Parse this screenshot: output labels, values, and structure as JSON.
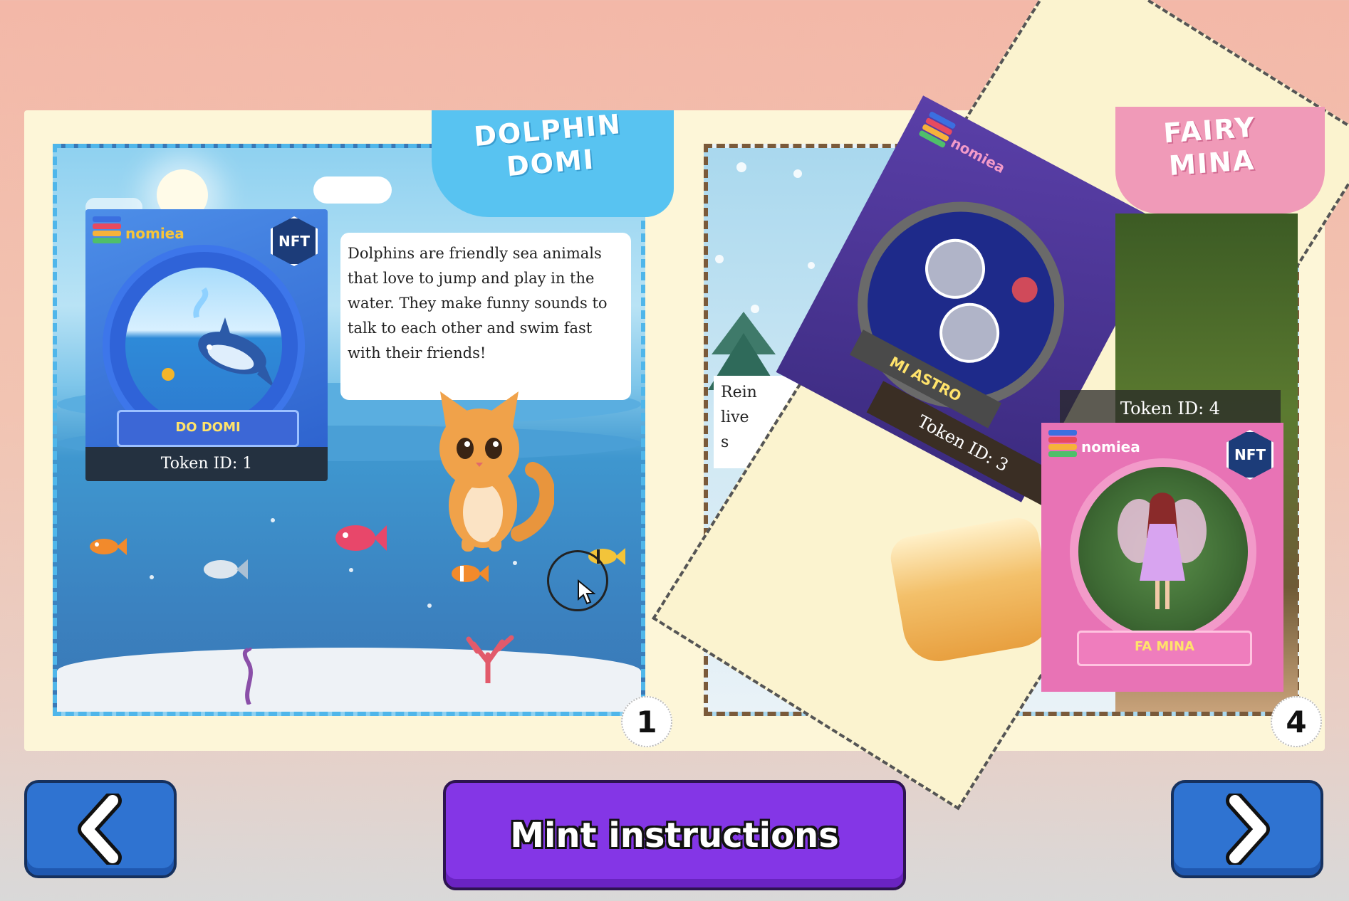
{
  "left_page": {
    "title_line1": "DOLPHIN",
    "title_line2": "DOMI",
    "story": "Dolphins are friendly sea animals that love to jump and play in the water. They make funny sounds to talk to each other and swim fast with their friends!",
    "card": {
      "brand": "nomiea",
      "badge": "NFT",
      "name": "DO DOMI",
      "token": "Token ID: 1"
    },
    "page_number": "1"
  },
  "right_page": {
    "title_line1": "FAIRY",
    "title_line2": "MINA",
    "partial_text_line1": "Rein",
    "partial_text_line2": "live",
    "partial_text_line3": "s",
    "astro_card": {
      "brand": "nomiea",
      "name": "MI ASTRO",
      "token": "Token ID: 3"
    },
    "mina_card": {
      "brand": "nomiea",
      "badge": "NFT",
      "name": "FA MINA",
      "token": "Token ID: 4"
    },
    "page_number": "4"
  },
  "buttons": {
    "prev_icon": "chevron-left-icon",
    "next_icon": "chevron-right-icon",
    "mint_label": "Mint instructions"
  },
  "colors": {
    "left_accent": "#4fb6ea",
    "right_accent": "#f09ab8",
    "nav_button": "#2f73d1",
    "mint_button": "#8436e6"
  }
}
